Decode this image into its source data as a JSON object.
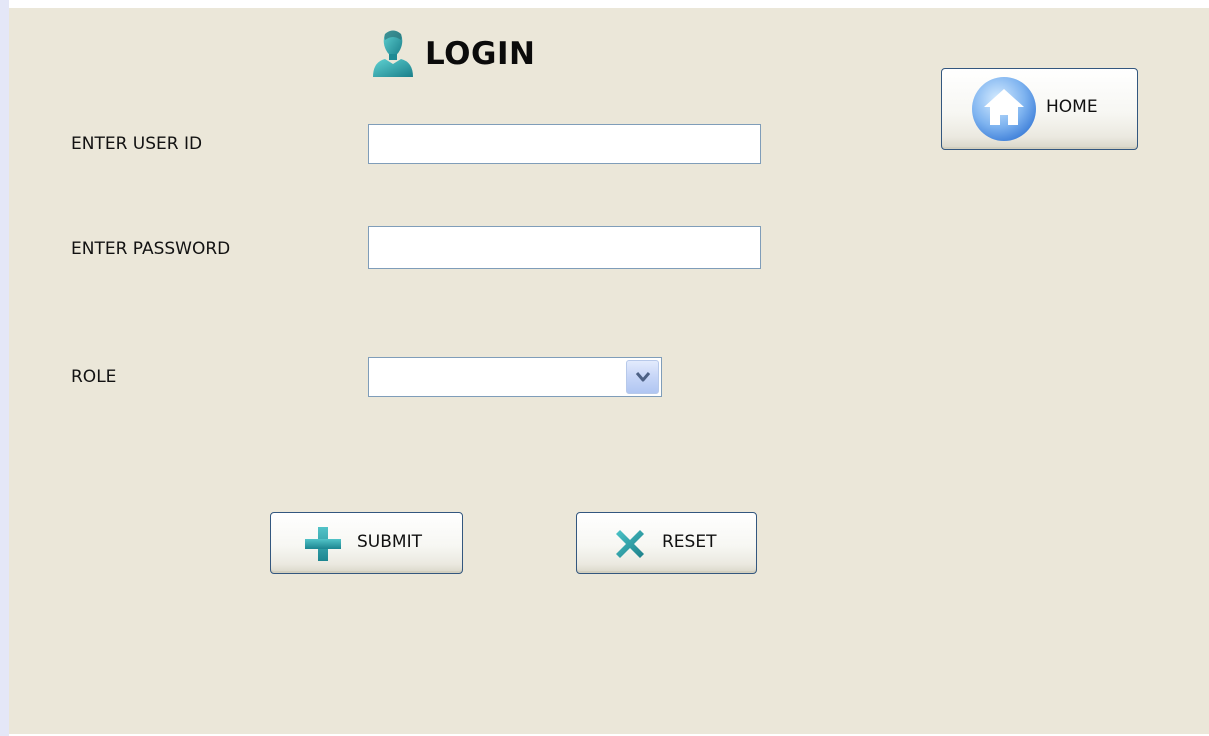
{
  "login": {
    "title": "LOGIN",
    "title_icon": "user-icon",
    "user_id_label": "ENTER USER ID",
    "user_id_value": "",
    "password_label": "ENTER PASSWORD",
    "password_value": "",
    "role_label": "ROLE",
    "role_selected": ""
  },
  "buttons": {
    "submit_label": "SUBMIT",
    "submit_icon": "plus-icon",
    "reset_label": "RESET",
    "reset_icon": "x-icon",
    "home_label": "HOME",
    "home_icon": "home-icon"
  },
  "colors": {
    "panel_background": "#ebe7d9",
    "field_border": "#7f9db9",
    "button_border": "#33577f",
    "icon_teal": "#2a9aa4"
  }
}
